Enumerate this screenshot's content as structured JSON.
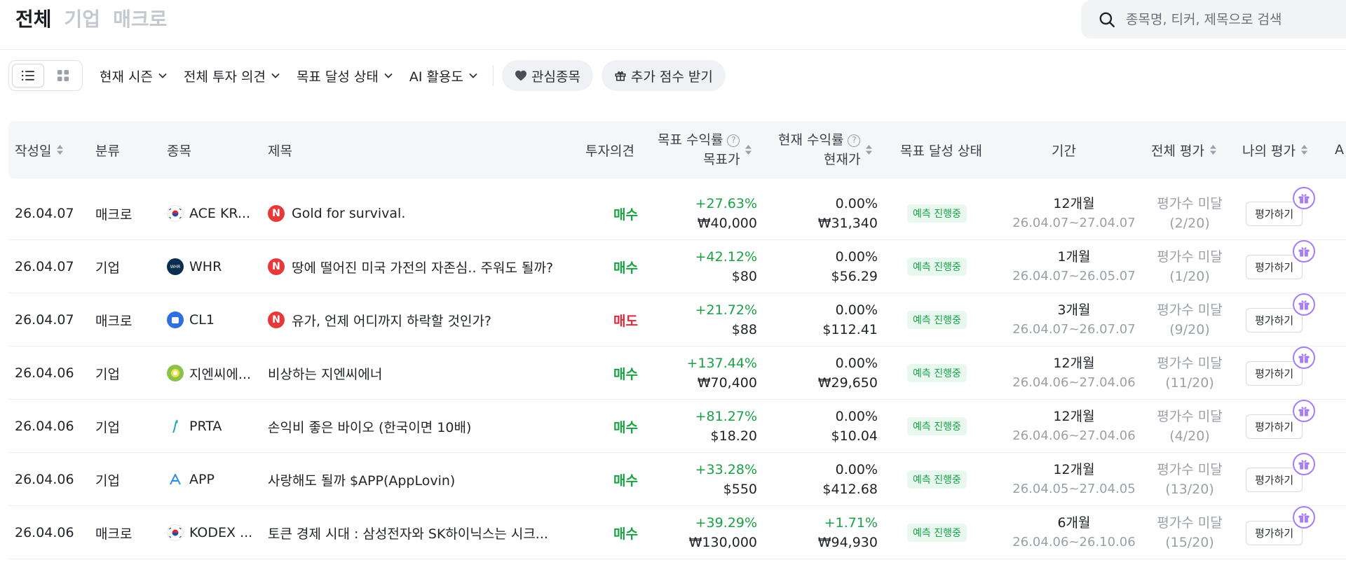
{
  "tabs": [
    "전체",
    "기업",
    "매크로"
  ],
  "search": {
    "placeholder": "종목명, 티커, 제목으로 검색"
  },
  "filters": {
    "season": "현재 시즌",
    "opinion": "전체 투자 의견",
    "goal_status": "목표 달성 상태",
    "ai_usage": "AI 활용도",
    "watchlist": "관심종목",
    "bonus": "추가 점수 받기"
  },
  "columns": {
    "date": "작성일",
    "category": "분류",
    "stock": "종목",
    "title": "제목",
    "opinion": "투자의견",
    "target_return": "목표 수익률",
    "target_price": "목표가",
    "current_return": "현재 수익률",
    "current_price": "현재가",
    "goal_status": "목표 달성 상태",
    "period": "기간",
    "overall_rating": "전체 평가",
    "my_rating": "나의 평가",
    "extra": "A"
  },
  "rows": [
    {
      "date": "26.04.07",
      "category": "매크로",
      "stock": "ACE KR...",
      "logo": "kr-flag",
      "is_new": true,
      "new_label": "N",
      "title": "Gold for survival.",
      "opinion": "매수",
      "opinion_type": "buy",
      "target_return": "+27.63%",
      "target_price": "₩40,000",
      "current_return": "0.00%",
      "current_price": "₩31,340",
      "status": "예측 진행중",
      "period": "12개월",
      "period_range": "26.04.07~27.04.07",
      "overall": "평가수 미달",
      "overall_count": "(2/20)",
      "rate_label": "평가하기"
    },
    {
      "date": "26.04.07",
      "category": "기업",
      "stock": "WHR",
      "logo": "whr",
      "is_new": true,
      "new_label": "N",
      "title": "땅에 떨어진 미국 가전의 자존심.. 주워도 될까?",
      "opinion": "매수",
      "opinion_type": "buy",
      "target_return": "+42.12%",
      "target_price": "$80",
      "current_return": "0.00%",
      "current_price": "$56.29",
      "status": "예측 진행중",
      "period": "1개월",
      "period_range": "26.04.07~26.05.07",
      "overall": "평가수 미달",
      "overall_count": "(1/20)",
      "rate_label": "평가하기"
    },
    {
      "date": "26.04.07",
      "category": "매크로",
      "stock": "CL1",
      "logo": "cl1",
      "is_new": true,
      "new_label": "N",
      "title": "유가, 언제 어디까지 하락할 것인가?",
      "opinion": "매도",
      "opinion_type": "sell",
      "target_return": "+21.72%",
      "target_price": "$88",
      "current_return": "0.00%",
      "current_price": "$112.41",
      "status": "예측 진행중",
      "period": "3개월",
      "period_range": "26.04.07~26.07.07",
      "overall": "평가수 미달",
      "overall_count": "(9/20)",
      "rate_label": "평가하기"
    },
    {
      "date": "26.04.06",
      "category": "기업",
      "stock": "지엔씨에...",
      "logo": "gnc",
      "is_new": false,
      "new_label": "",
      "title": "비상하는 지엔씨에너",
      "opinion": "매수",
      "opinion_type": "buy",
      "target_return": "+137.44%",
      "target_price": "₩70,400",
      "current_return": "0.00%",
      "current_price": "₩29,650",
      "status": "예측 진행중",
      "period": "12개월",
      "period_range": "26.04.06~27.04.06",
      "overall": "평가수 미달",
      "overall_count": "(11/20)",
      "rate_label": "평가하기"
    },
    {
      "date": "26.04.06",
      "category": "기업",
      "stock": "PRTA",
      "logo": "prta",
      "is_new": false,
      "new_label": "",
      "title": "손익비 좋은 바이오 (한국이면 10배)",
      "opinion": "매수",
      "opinion_type": "buy",
      "target_return": "+81.27%",
      "target_price": "$18.20",
      "current_return": "0.00%",
      "current_price": "$10.04",
      "status": "예측 진행중",
      "period": "12개월",
      "period_range": "26.04.06~27.04.06",
      "overall": "평가수 미달",
      "overall_count": "(4/20)",
      "rate_label": "평가하기"
    },
    {
      "date": "26.04.06",
      "category": "기업",
      "stock": "APP",
      "logo": "app",
      "is_new": false,
      "new_label": "",
      "title": "사랑해도 될까 $APP(AppLovin)",
      "opinion": "매수",
      "opinion_type": "buy",
      "target_return": "+33.28%",
      "target_price": "$550",
      "current_return": "0.00%",
      "current_price": "$412.68",
      "status": "예측 진행중",
      "period": "12개월",
      "period_range": "26.04.05~27.04.05",
      "overall": "평가수 미달",
      "overall_count": "(13/20)",
      "rate_label": "평가하기"
    },
    {
      "date": "26.04.06",
      "category": "매크로",
      "stock": "KODEX ...",
      "logo": "kr-flag",
      "is_new": false,
      "new_label": "",
      "title": "토큰 경제 시대 : 삼성전자와 SK하이닉스는 시크...",
      "opinion": "매수",
      "opinion_type": "buy",
      "target_return": "+39.29%",
      "target_price": "₩130,000",
      "current_return": "+1.71%",
      "current_price": "₩94,930",
      "status": "예측 진행중",
      "period": "6개월",
      "period_range": "26.04.06~26.10.06",
      "overall": "평가수 미달",
      "overall_count": "(15/20)",
      "rate_label": "평가하기"
    }
  ],
  "colors": {
    "buy": "#1aa145",
    "sell": "#e0293a",
    "badge_bg": "#e9f8ee",
    "new": "#e63a3a",
    "gift": "#a57cf3"
  }
}
